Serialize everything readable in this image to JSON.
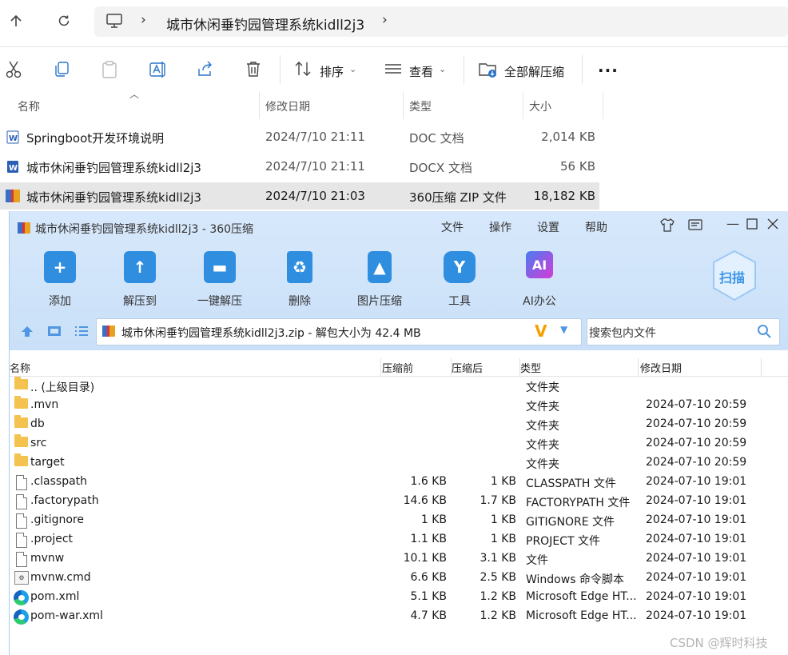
{
  "explorer": {
    "breadcrumb_folder": "城市休闲垂钓园管理系统kidll2j3",
    "toolbar": {
      "sort_label": "排序",
      "view_label": "查看",
      "extract_all_label": "全部解压缩",
      "more_label": "..."
    },
    "columns": {
      "name": "名称",
      "modified": "修改日期",
      "type": "类型",
      "size": "大小"
    },
    "files": [
      {
        "name": "Springboot开发环境说明",
        "modified": "2024/7/10 21:11",
        "type": "DOC 文档",
        "size": "2,014 KB",
        "icon": "word-doc-icon"
      },
      {
        "name": "城市休闲垂钓园管理系统kidll2j3",
        "modified": "2024/7/10 21:11",
        "type": "DOCX 文档",
        "size": "56 KB",
        "icon": "word-doc-icon"
      },
      {
        "name": "城市休闲垂钓园管理系统kidll2j3",
        "modified": "2024/7/10 21:03",
        "type": "360压缩 ZIP 文件",
        "size": "18,182 KB",
        "icon": "zip-archive-icon"
      }
    ]
  },
  "zipwin": {
    "title": "城市休闲垂钓园管理系统kidll2j3 - 360压缩",
    "menu": [
      "文件",
      "操作",
      "设置",
      "帮助"
    ],
    "buttons": [
      {
        "label": "添加",
        "icon": "add-icon",
        "color": "#2f8ee0"
      },
      {
        "label": "解压到",
        "icon": "extract-to-icon",
        "color": "#2f8ee0"
      },
      {
        "label": "一键解压",
        "icon": "one-click-extract-icon",
        "color": "#2f8ee0"
      },
      {
        "label": "删除",
        "icon": "recycle-icon",
        "color": "#2f8ee0"
      },
      {
        "label": "图片压缩",
        "icon": "image-compress-icon",
        "color": "#2f8ee0"
      },
      {
        "label": "工具",
        "icon": "tools-icon",
        "color": "#2f8ee0"
      },
      {
        "label": "AI办公",
        "icon": "ai-office-icon",
        "color": "#c23ee0"
      }
    ],
    "scan_label": "扫描",
    "path_text": "城市休闲垂钓园管理系统kidll2j3.zip - 解包大小为 42.4 MB",
    "search_placeholder": "搜索包内文件",
    "columns": {
      "name": "名称",
      "before": "压缩前",
      "after": "压缩后",
      "type": "类型",
      "modified": "修改日期"
    },
    "rows": [
      {
        "name": ".. (上级目录)",
        "before": "",
        "after": "",
        "type": "文件夹",
        "modified": "",
        "icon": "folder"
      },
      {
        "name": ".mvn",
        "before": "",
        "after": "",
        "type": "文件夹",
        "modified": "2024-07-10 20:59",
        "icon": "folder"
      },
      {
        "name": "db",
        "before": "",
        "after": "",
        "type": "文件夹",
        "modified": "2024-07-10 20:59",
        "icon": "folder"
      },
      {
        "name": "src",
        "before": "",
        "after": "",
        "type": "文件夹",
        "modified": "2024-07-10 20:59",
        "icon": "folder"
      },
      {
        "name": "target",
        "before": "",
        "after": "",
        "type": "文件夹",
        "modified": "2024-07-10 20:59",
        "icon": "folder"
      },
      {
        "name": ".classpath",
        "before": "1.6 KB",
        "after": "1 KB",
        "type": "CLASSPATH 文件",
        "modified": "2024-07-10 19:01",
        "icon": "doc"
      },
      {
        "name": ".factorypath",
        "before": "14.6 KB",
        "after": "1.7 KB",
        "type": "FACTORYPATH 文件",
        "modified": "2024-07-10 19:01",
        "icon": "doc"
      },
      {
        "name": ".gitignore",
        "before": "1 KB",
        "after": "1 KB",
        "type": "GITIGNORE 文件",
        "modified": "2024-07-10 19:01",
        "icon": "doc"
      },
      {
        "name": ".project",
        "before": "1.1 KB",
        "after": "1 KB",
        "type": "PROJECT 文件",
        "modified": "2024-07-10 19:01",
        "icon": "doc"
      },
      {
        "name": "mvnw",
        "before": "10.1 KB",
        "after": "3.1 KB",
        "type": "文件",
        "modified": "2024-07-10 19:01",
        "icon": "doc"
      },
      {
        "name": "mvnw.cmd",
        "before": "6.6 KB",
        "after": "2.5 KB",
        "type": "Windows 命令脚本",
        "modified": "2024-07-10 19:01",
        "icon": "cmd"
      },
      {
        "name": "pom.xml",
        "before": "5.1 KB",
        "after": "1.2 KB",
        "type": "Microsoft Edge HT...",
        "modified": "2024-07-10 19:01",
        "icon": "edge"
      },
      {
        "name": "pom-war.xml",
        "before": "4.7 KB",
        "after": "1.2 KB",
        "type": "Microsoft Edge HT...",
        "modified": "2024-07-10 19:01",
        "icon": "edge"
      }
    ]
  },
  "watermark": "CSDN @辉时科技"
}
